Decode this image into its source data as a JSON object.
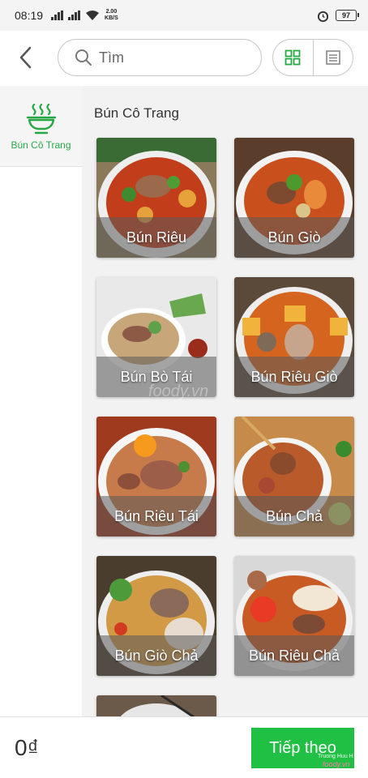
{
  "status_bar": {
    "time": "08:19",
    "net_speed_top": "2.00",
    "net_speed_bottom": "KB/S",
    "battery": "97"
  },
  "header": {
    "search_placeholder": "Tìm",
    "icons": [
      "back-icon",
      "search-icon",
      "grid-view-icon",
      "list-view-icon"
    ]
  },
  "sidebar": {
    "categories": [
      {
        "label": "Bún Cô Trang",
        "icon": "noodle-bowl-icon",
        "selected": true
      }
    ]
  },
  "main": {
    "section_title": "Bún Cô Trang",
    "items": [
      {
        "name": "Bún Riêu"
      },
      {
        "name": "Bún Giò"
      },
      {
        "name": "Bún Bò Tái"
      },
      {
        "name": "Bún Riêu Giò"
      },
      {
        "name": "Bún Riêu Tái"
      },
      {
        "name": "Bún Chả"
      },
      {
        "name": "Bún Giò Chả"
      },
      {
        "name": "Bún Riêu Chả"
      }
    ]
  },
  "bottom_bar": {
    "total": "0₫",
    "next_label": "Tiếp theo"
  },
  "watermarks": {
    "small": "Truong Huu H",
    "brand": "foody.vn",
    "mid": "foody.vn"
  },
  "colors": {
    "accent_green": "#28a745",
    "button_green": "#1fc043"
  }
}
